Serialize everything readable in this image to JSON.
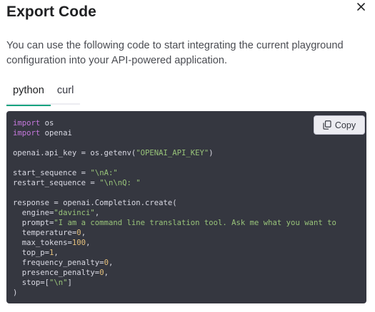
{
  "dialog": {
    "title": "Export Code",
    "description": "You can use the following code to start integrating the current playground configuration into your API-powered application.",
    "close_icon": "close-icon"
  },
  "tabs": [
    {
      "label": "python",
      "active": true
    },
    {
      "label": "curl",
      "active": false
    }
  ],
  "copy_button": {
    "label": "Copy",
    "icon": "copy-icon"
  },
  "code": {
    "lines": [
      [
        {
          "t": "import",
          "c": "kw"
        },
        {
          "t": " os"
        }
      ],
      [
        {
          "t": "import",
          "c": "kw"
        },
        {
          "t": " openai"
        }
      ],
      [],
      [
        {
          "t": "openai.api_key = os.getenv("
        },
        {
          "t": "\"OPENAI_API_KEY\"",
          "c": "str"
        },
        {
          "t": ")"
        }
      ],
      [],
      [
        {
          "t": "start_sequence = "
        },
        {
          "t": "\"\\nA:\"",
          "c": "str"
        }
      ],
      [
        {
          "t": "restart_sequence = "
        },
        {
          "t": "\"\\n\\nQ: \"",
          "c": "str"
        }
      ],
      [],
      [
        {
          "t": "response = openai.Completion.create("
        }
      ],
      [
        {
          "t": "  engine="
        },
        {
          "t": "\"davinci\"",
          "c": "str"
        },
        {
          "t": ","
        }
      ],
      [
        {
          "t": "  prompt="
        },
        {
          "t": "\"I am a command line translation tool. Ask me what you want to",
          "c": "str"
        }
      ],
      [
        {
          "t": "  temperature="
        },
        {
          "t": "0",
          "c": "num"
        },
        {
          "t": ","
        }
      ],
      [
        {
          "t": "  max_tokens="
        },
        {
          "t": "100",
          "c": "num"
        },
        {
          "t": ","
        }
      ],
      [
        {
          "t": "  top_p="
        },
        {
          "t": "1",
          "c": "num"
        },
        {
          "t": ","
        }
      ],
      [
        {
          "t": "  frequency_penalty="
        },
        {
          "t": "0",
          "c": "num"
        },
        {
          "t": ","
        }
      ],
      [
        {
          "t": "  presence_penalty="
        },
        {
          "t": "0",
          "c": "num"
        },
        {
          "t": ","
        }
      ],
      [
        {
          "t": "  stop=["
        },
        {
          "t": "\"\\n\"",
          "c": "str"
        },
        {
          "t": "]"
        }
      ],
      [
        {
          "t": ")"
        }
      ]
    ]
  },
  "colors": {
    "accent": "#10a37f",
    "code_bg": "#353740",
    "keyword": "#c678dd",
    "string": "#98c379",
    "number": "#e5c07b"
  }
}
